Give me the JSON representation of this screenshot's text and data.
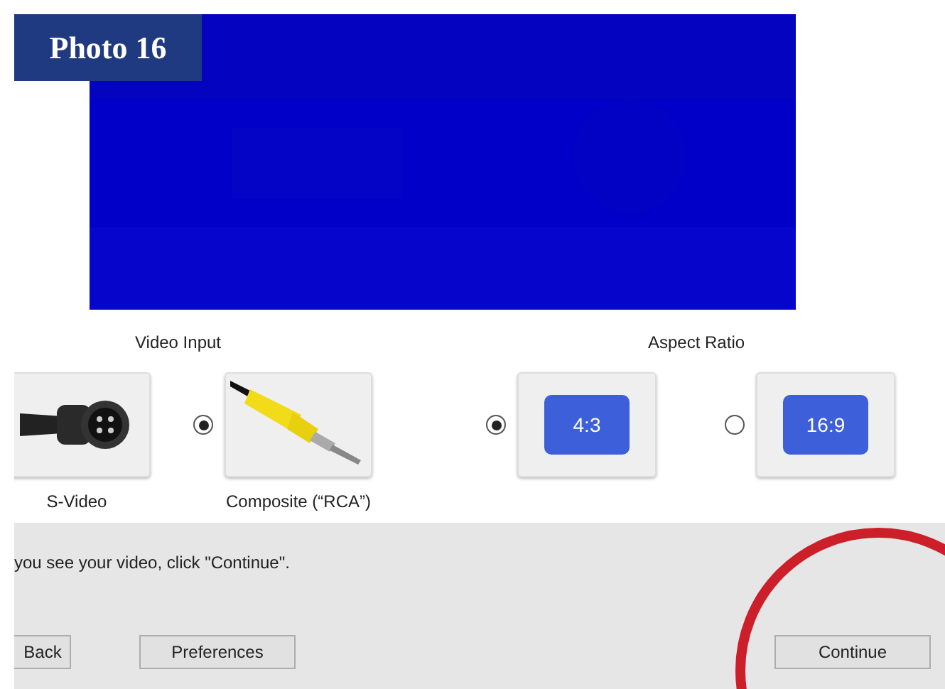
{
  "badge": {
    "text": "Photo 16"
  },
  "video_input": {
    "heading": "Video Input",
    "options": [
      {
        "label": "S-Video",
        "kind": "svideo"
      },
      {
        "label": "Composite (“RCA”)",
        "kind": "rca",
        "selected": true
      }
    ]
  },
  "aspect_ratio": {
    "heading": "Aspect Ratio",
    "options": [
      {
        "label": "4:3",
        "selected": true
      },
      {
        "label": "16:9",
        "selected": false
      }
    ]
  },
  "message": "you see your video, click \"Continue\".",
  "buttons": [
    {
      "label": "Back",
      "kind": "clipped"
    },
    {
      "label": "Preferences",
      "kind": "normal"
    },
    {
      "label": "Continue",
      "kind": "primary"
    }
  ]
}
